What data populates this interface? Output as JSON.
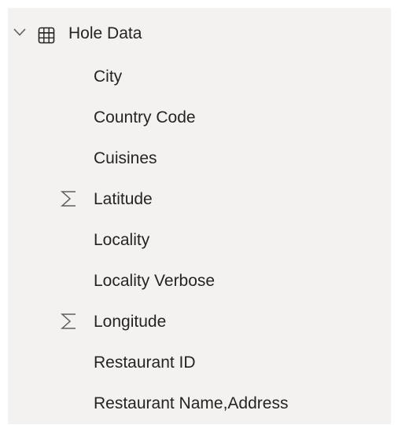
{
  "table": {
    "name": "Hole Data",
    "expanded": true,
    "icons": {
      "expand": "chevron-down-icon",
      "table": "table-icon"
    }
  },
  "fields": [
    {
      "label": "City",
      "icon": null
    },
    {
      "label": "Country Code",
      "icon": null
    },
    {
      "label": "Cuisines",
      "icon": null
    },
    {
      "label": "Latitude",
      "icon": "sigma-icon"
    },
    {
      "label": "Locality",
      "icon": null
    },
    {
      "label": "Locality Verbose",
      "icon": null
    },
    {
      "label": "Longitude",
      "icon": "sigma-icon"
    },
    {
      "label": "Restaurant ID",
      "icon": null
    },
    {
      "label": "Restaurant Name,Address",
      "icon": null
    }
  ],
  "colors": {
    "pane_background": "#f3f2f1",
    "text": "#252423",
    "icon": "#605e5c"
  }
}
